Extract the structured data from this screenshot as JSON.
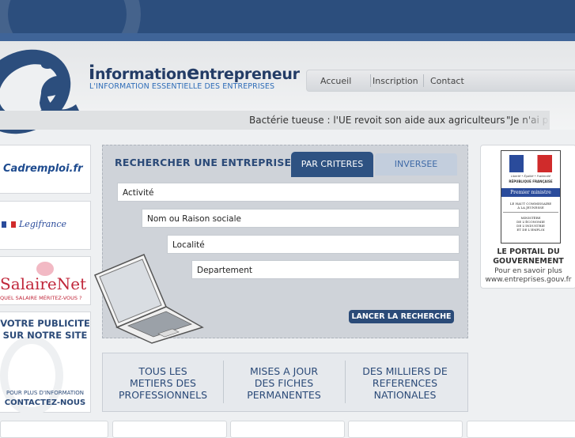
{
  "brand": {
    "prefix_i": "i",
    "word1": "nformation",
    "prefix_e": "e",
    "word2": "ntrepreneur",
    "tagline": "L'INFORMATION ESSENTIELLE DES ENTREPRISES"
  },
  "nav": {
    "items": [
      "Accueil",
      "Inscription",
      "Contact"
    ]
  },
  "ticker": {
    "items": [
      "Bactérie tueuse : l'UE revoit son aide aux agriculteurs",
      "\"Je n'ai p"
    ]
  },
  "sidebar": {
    "cadremploi": "Cadremploi.fr",
    "legifrance": "Legifrance",
    "salairenet_main": "SalaireNet",
    "salairenet_sub": "QUEL SALAIRE MÉRITEZ-VOUS ?",
    "pub_line1": "VOTRE PUBLICITE",
    "pub_line2": "SUR NOTRE SITE",
    "pub_small": "POUR PLUS D'INFORMATION",
    "pub_contact": "CONTACTEZ-NOUS"
  },
  "search": {
    "title": "RECHERCHER UNE ENTREPRISE",
    "tab_active": "PAR CRITERES",
    "tab_inactive": "INVERSEE",
    "fields": [
      "Activité",
      "Nom ou Raison sociale",
      "Localité",
      "Departement"
    ],
    "button": "LANCER LA RECHERCHE"
  },
  "features": [
    {
      "l1": "TOUS LES",
      "l2": "METIERS DES",
      "l3": "PROFESSIONNELS"
    },
    {
      "l1": "MISES A JOUR",
      "l2": "DES FICHES",
      "l3": "PERMANENTES"
    },
    {
      "l1": "DES MILLIERS DE",
      "l2": "REFERENCES",
      "l3": "NATIONALES"
    }
  ],
  "gov": {
    "motto": "Liberté • Égalité • Fraternité",
    "republic": "RÉPUBLIQUE FRANÇAISE",
    "pm": "Premier ministre",
    "hc1": "LE HAUT COMMISSAIRE",
    "hc2": "À LA JEUNESSE",
    "min1": "MINISTÈRE",
    "min2": "DE L'ÉCONOMIE",
    "min3": "DE L'INDUSTRIE",
    "min4": "ET DE L'EMPLOI",
    "title1": "LE PORTAIL DU",
    "title2": "GOUVERNEMENT",
    "more": "Pour en savoir plus",
    "url": "www.entreprises.gouv.fr"
  },
  "colors": {
    "navy": "#2c4e7d",
    "accent_blue": "#2f6db8",
    "button": "#2b4b78"
  }
}
